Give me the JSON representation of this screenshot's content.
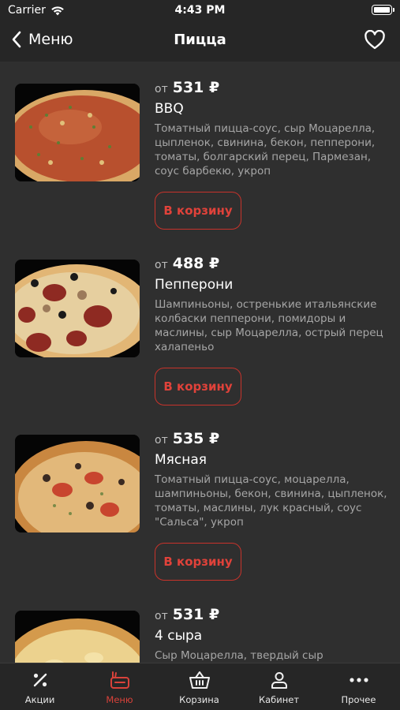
{
  "status_bar": {
    "carrier": "Carrier",
    "time": "4:43 PM"
  },
  "nav": {
    "back_label": "Меню",
    "title": "Пицца"
  },
  "price_prefix": "от",
  "cart_label": "В корзину",
  "items": [
    {
      "price": "531 ₽",
      "name": "BBQ",
      "description": "Томатный пицца-соус, сыр Моцарелла, цыпленок, свинина, бекон, пепперони, томаты, болгарский перец, Пармезан, соус барбекю, укроп"
    },
    {
      "price": "488 ₽",
      "name": "Пепперони",
      "description": "Шампиньоны, остренькие итальянские колбаски пепперони, помидоры и маслины, сыр Моцарелла, острый перец халапеньо"
    },
    {
      "price": "535 ₽",
      "name": "Мясная",
      "description": "Томатный пицца-соус, моцарелла, шампиньоны, бекон, свинина, цыпленок, томаты, маслины, лук красный, соус \"Сальса\", укроп"
    },
    {
      "price": "531 ₽",
      "name": "4 сыра",
      "description": "Сыр Моцарелла, твердый сыр"
    }
  ],
  "tabs": [
    {
      "label": "Акции",
      "icon": "percent-icon"
    },
    {
      "label": "Меню",
      "icon": "menu-bag-icon",
      "active": true
    },
    {
      "label": "Корзина",
      "icon": "basket-icon"
    },
    {
      "label": "Кабинет",
      "icon": "user-icon"
    },
    {
      "label": "Прочее",
      "icon": "more-icon"
    }
  ],
  "colors": {
    "accent": "#d9423a",
    "background": "#2f2f2f",
    "bar": "#262626"
  }
}
